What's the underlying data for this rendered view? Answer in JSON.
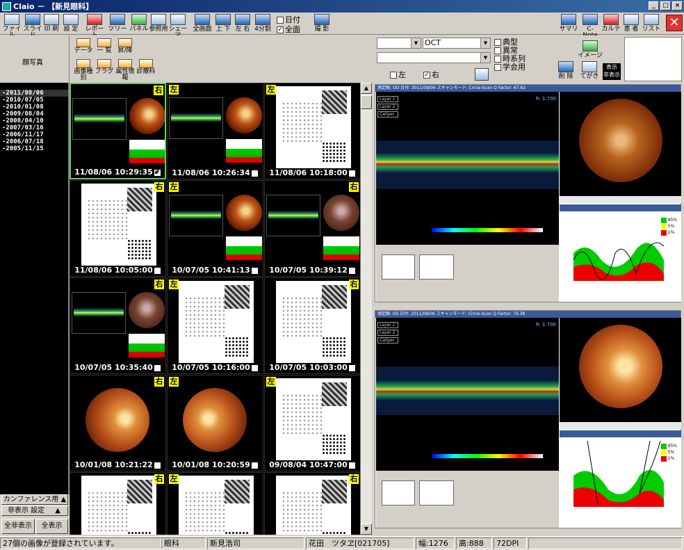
{
  "window": {
    "title": "Claio － 【新見眼科】"
  },
  "toolbar": {
    "items": [
      "ファイル",
      "スライド",
      "印 刷",
      "設 定",
      "レポート",
      "ツリー",
      "パネル",
      "参照用",
      "シェーマ",
      "全画面",
      "上 下",
      "左 右",
      "4分割",
      "撮 影"
    ],
    "date_checkbox": "日付",
    "all_checkbox": "全面",
    "right_items": [
      "サマリ",
      "C-Note",
      "カルテ",
      "患 者",
      "リスト"
    ]
  },
  "left_header": {
    "title": "顔写真"
  },
  "grid_header": {
    "buttons": [
      "データ",
      "一 覧",
      "昇/降",
      "画像種別",
      "フラグ",
      "属性情報",
      "診療科"
    ]
  },
  "date_list": [
    "2011/08/06",
    "2010/07/05",
    "2010/01/08",
    "2009/08/04",
    "2008/04/10",
    "2007/03/16",
    "2006/11/17",
    "2006/07/18",
    "2005/11/15"
  ],
  "left_buttons": {
    "conference": "カンファレンス用 ▲",
    "hide_settings": "非表示 設定",
    "hide_settings_arrow": "▲",
    "hide_all": "全非表示",
    "show_all": "全表示"
  },
  "thumbnails": [
    {
      "eye": "右",
      "type": "oct",
      "stamp": "11/08/06 10:29:35",
      "checked": true
    },
    {
      "eye": "左",
      "type": "oct",
      "stamp": "11/08/06 10:26:34",
      "checked": false
    },
    {
      "eye": "左",
      "type": "vf",
      "stamp": "11/08/06 10:18:00",
      "checked": false
    },
    {
      "eye": "右",
      "type": "vf",
      "stamp": "11/08/06 10:05:00",
      "checked": false
    },
    {
      "eye": "左",
      "type": "oct",
      "stamp": "10/07/05 10:41:13",
      "checked": false
    },
    {
      "eye": "右",
      "type": "oct",
      "stamp": "10/07/05 10:39:12",
      "checked": false
    },
    {
      "eye": "右",
      "type": "oct",
      "stamp": "10/07/05 10:35:40",
      "checked": false
    },
    {
      "eye": "左",
      "type": "vf",
      "stamp": "10/07/05 10:16:00",
      "checked": false
    },
    {
      "eye": "右",
      "type": "vf",
      "stamp": "10/07/05 10:03:00",
      "checked": false
    },
    {
      "eye": "右",
      "type": "fundus",
      "stamp": "10/01/08 10:21:22",
      "checked": false
    },
    {
      "eye": "左",
      "type": "fundus",
      "stamp": "10/01/08 10:20:59",
      "checked": false
    },
    {
      "eye": "左",
      "type": "vf",
      "stamp": "09/08/04 10:47:00",
      "checked": false
    },
    {
      "eye": "右",
      "type": "vf",
      "stamp": "",
      "checked": false
    },
    {
      "eye": "左",
      "type": "vf",
      "stamp": "",
      "checked": false
    },
    {
      "eye": "右",
      "type": "vf",
      "stamp": "",
      "checked": false
    }
  ],
  "right_header": {
    "combo1": "",
    "combo2": "OCT",
    "combo3": "",
    "check_typical": "典型",
    "check_abnormal": "異常",
    "check_timeseries": "時系列",
    "check_conference": "学会用",
    "left_eye": "左",
    "right_eye": "右",
    "image_btn": "イメージ",
    "delete_btn": "削 除",
    "handwrite_btn": "てがき",
    "display_btn": "表示",
    "hide_btn": "非表示"
  },
  "viewers": [
    {
      "title": "測定眼: OD    日付: 2011/08/06    スキャンモード: Circle-Scan   Q Factor: 67.62",
      "layers": [
        "Layer 1",
        "Layer 2",
        "Caliper"
      ],
      "r_value": "R: 1.700"
    },
    {
      "title": "測定眼: OS    日付: 2011/08/06    スキャンモード: Circle-Scan   Q Factor: 76.38",
      "layers": [
        "Layer 1",
        "Layer 2",
        "Caliper"
      ],
      "r_value": "R: 1.700"
    }
  ],
  "legend": [
    "95%",
    "5%",
    "1%"
  ],
  "status": {
    "message": "27個の画像が登録されています。",
    "department": "眼科",
    "doctor": "新見浩司",
    "patient": "花田　ツタヱ[021705]",
    "width": "幅:1276",
    "height": "高:888",
    "dpi": "72DPI"
  },
  "colors": {
    "title_bar": "#0a246a",
    "grid_bg": "#000000",
    "eye_tag": "#ffff00",
    "selection": "#66cc66"
  }
}
